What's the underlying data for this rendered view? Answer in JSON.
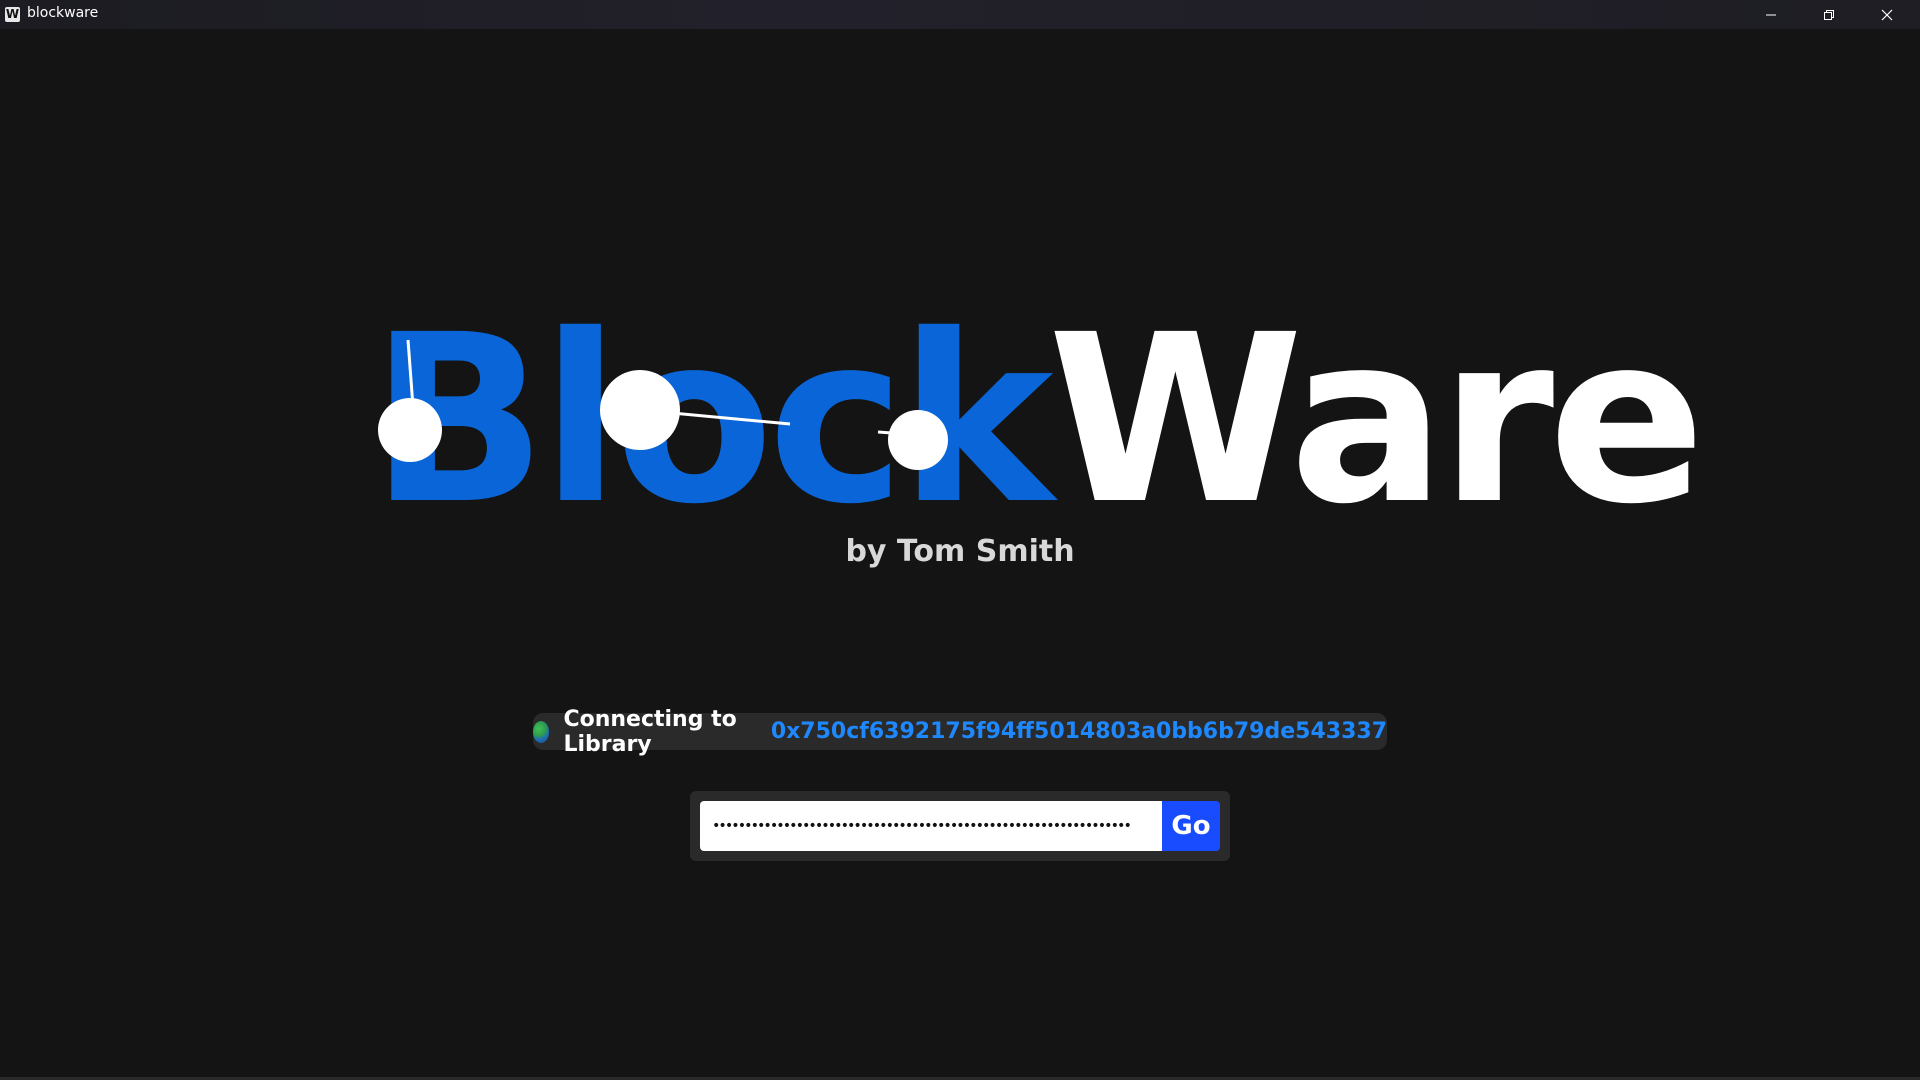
{
  "window": {
    "title": "blockware",
    "app_icon_letter": "W",
    "controls": [
      "minimize-icon",
      "restore-icon",
      "close-icon"
    ]
  },
  "logo": {
    "part_one": "Block",
    "part_two": "Ware",
    "colors": {
      "part_one": "#0a66d8",
      "part_two": "#ffffff"
    }
  },
  "subtitle": "by Tom Smith",
  "status": {
    "icon": "globe-icon",
    "label": "Connecting to Library",
    "address": "0x750cf6392175f94ff5014803a0bb6b79de543337"
  },
  "login": {
    "password_value": "•••••••••••••••••••••••••••••••••••••••••••••••••••••••••••••••••",
    "go_label": "Go"
  },
  "colors": {
    "background": "#141414",
    "accent": "#1a4cff",
    "link": "#1e88ff"
  }
}
